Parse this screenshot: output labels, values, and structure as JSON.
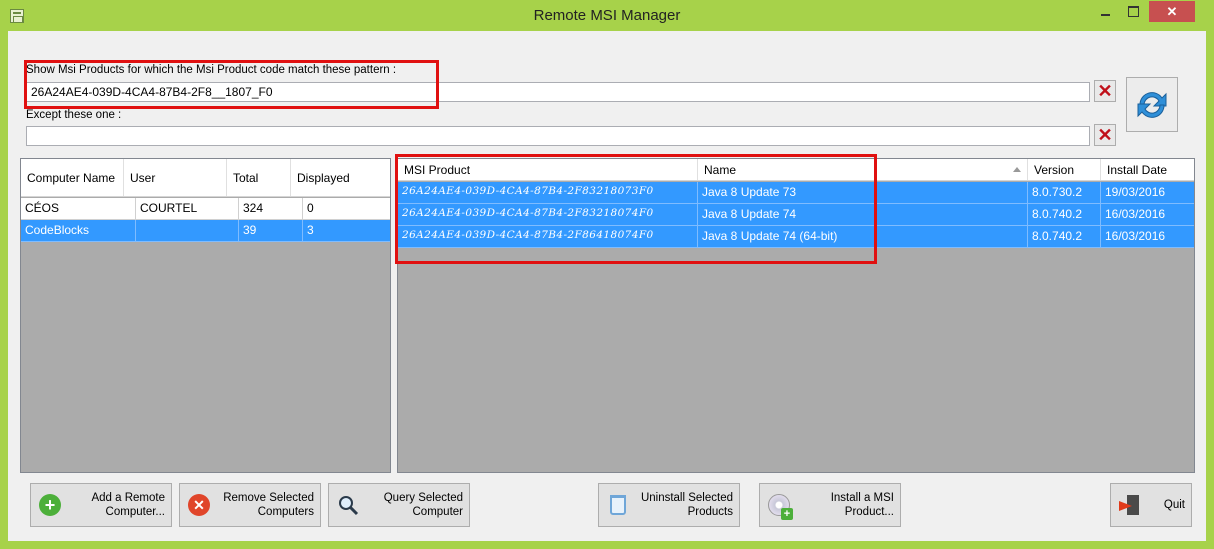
{
  "window": {
    "title": "Remote MSI Manager"
  },
  "filter": {
    "include_label": "Show Msi Products for which the Msi Product code match these pattern :",
    "include_value": "26A24AE4-039D-4CA4-87B4-2F8__1807_F0",
    "exclude_label": "Except these one :",
    "exclude_value": ""
  },
  "computers": {
    "columns": [
      "Computer Name",
      "User",
      "Total",
      "Displayed"
    ],
    "rows": [
      {
        "name": "CÉOS",
        "user": "COURTEL",
        "total": "324",
        "displayed": "0",
        "selected": false
      },
      {
        "name": "CodeBlocks",
        "user": "",
        "total": "39",
        "displayed": "3",
        "selected": true
      }
    ]
  },
  "products": {
    "columns": [
      "MSI Product",
      "Name",
      "Version",
      "Install Date"
    ],
    "sort_column": "Name",
    "rows": [
      {
        "code": "26A24AE4-039D-4CA4-87B4-2F83218073F0",
        "name": "Java 8 Update 73",
        "version": "8.0.730.2",
        "date": "19/03/2016"
      },
      {
        "code": "26A24AE4-039D-4CA4-87B4-2F83218074F0",
        "name": "Java 8 Update 74",
        "version": "8.0.740.2",
        "date": "16/03/2016"
      },
      {
        "code": "26A24AE4-039D-4CA4-87B4-2F86418074F0",
        "name": "Java 8 Update 74 (64-bit)",
        "version": "8.0.740.2",
        "date": "16/03/2016"
      }
    ]
  },
  "buttons": {
    "add_remote": "Add a Remote\nComputer...",
    "remove_selected": "Remove Selected\nComputers",
    "query_selected": "Query Selected\nComputer",
    "uninstall_selected": "Uninstall Selected\nProducts",
    "install_msi": "Install a MSI\nProduct...",
    "quit": "Quit"
  },
  "colors": {
    "selection": "#3399ff",
    "highlight_box": "#e01010",
    "title_bar": "#a7d24a",
    "close_button": "#c75050"
  }
}
